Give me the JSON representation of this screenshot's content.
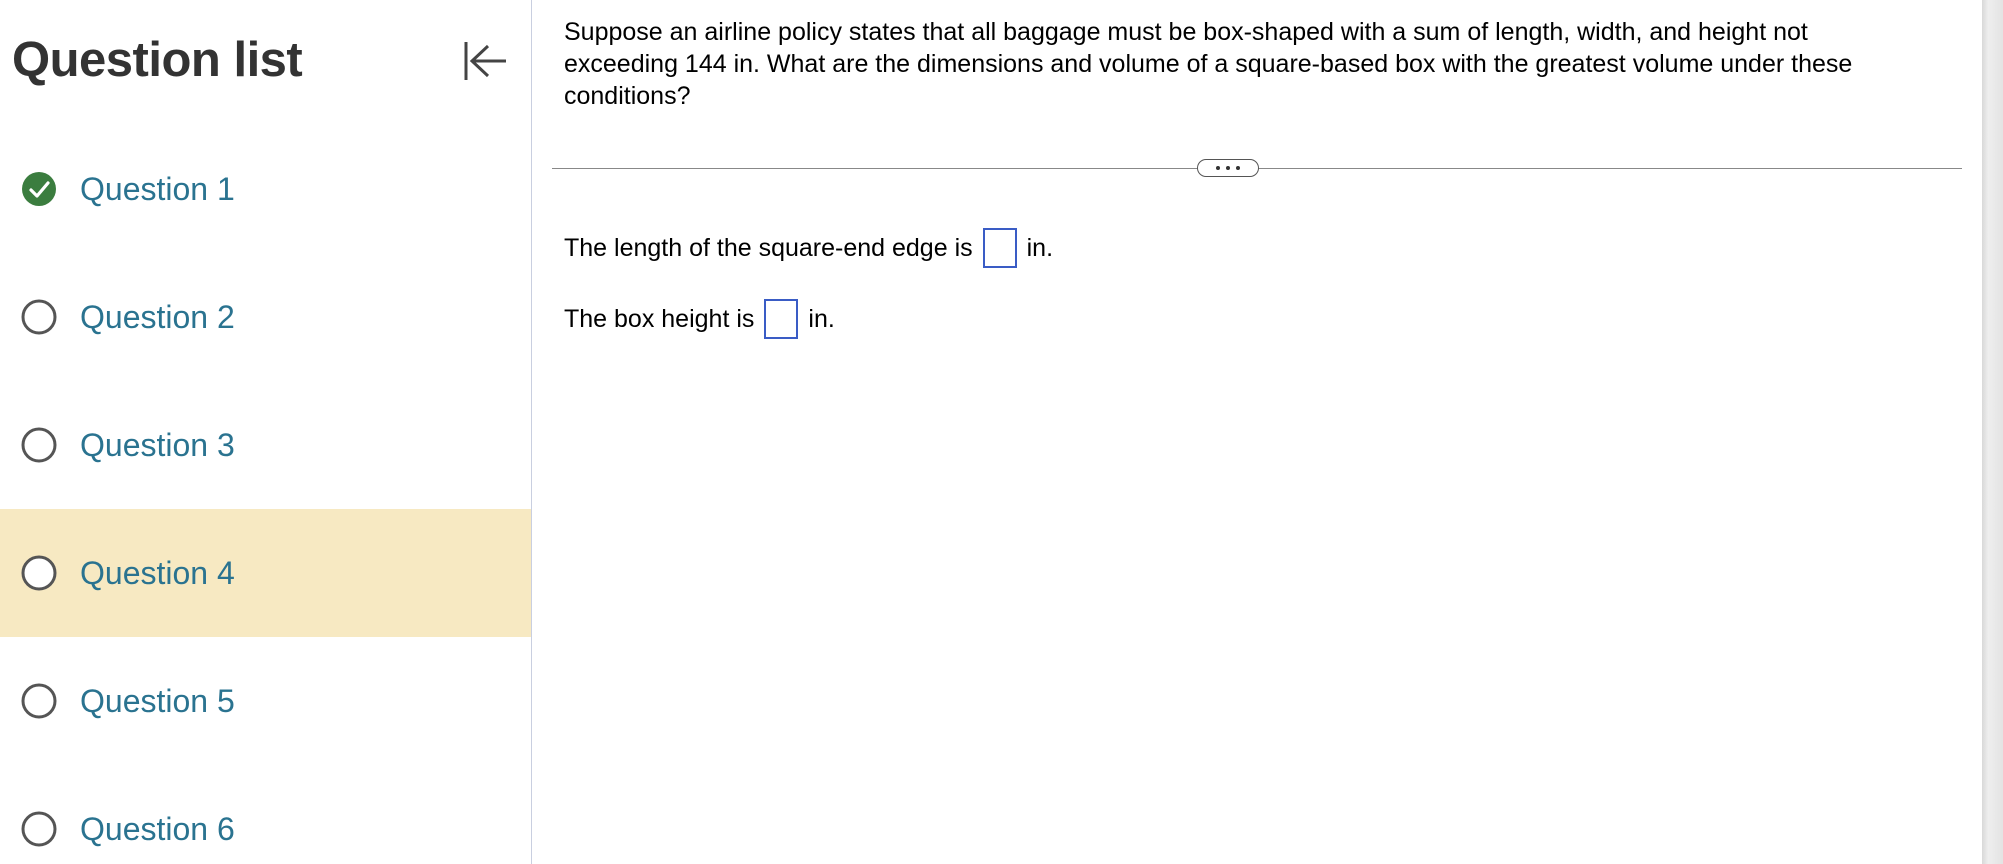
{
  "sidebar": {
    "title": "Question list",
    "collapse_icon": "collapse-left-icon",
    "questions": [
      {
        "label": "Question 1",
        "status": "completed",
        "active": false
      },
      {
        "label": "Question 2",
        "status": "not-started",
        "active": false
      },
      {
        "label": "Question 3",
        "status": "not-started",
        "active": false
      },
      {
        "label": "Question 4",
        "status": "not-started",
        "active": true
      },
      {
        "label": "Question 5",
        "status": "not-started",
        "active": false
      },
      {
        "label": "Question 6",
        "status": "not-started",
        "active": false
      }
    ]
  },
  "main": {
    "question": "Suppose an airline policy states that all baggage must be box-shaped with a sum of length, width, and height not exceeding 144 in. What are the dimensions and volume of a square-based box with the greatest volume under these conditions?",
    "answers": [
      {
        "prefix": "The length of the square-end edge is",
        "value": "",
        "suffix": "in."
      },
      {
        "prefix": "The box height is",
        "value": "",
        "suffix": "in."
      }
    ]
  },
  "colors": {
    "active_row": "#f7e9c2",
    "link": "#2a7390",
    "check_green": "#3b7d3f",
    "input_border": "#3a5cc5"
  }
}
